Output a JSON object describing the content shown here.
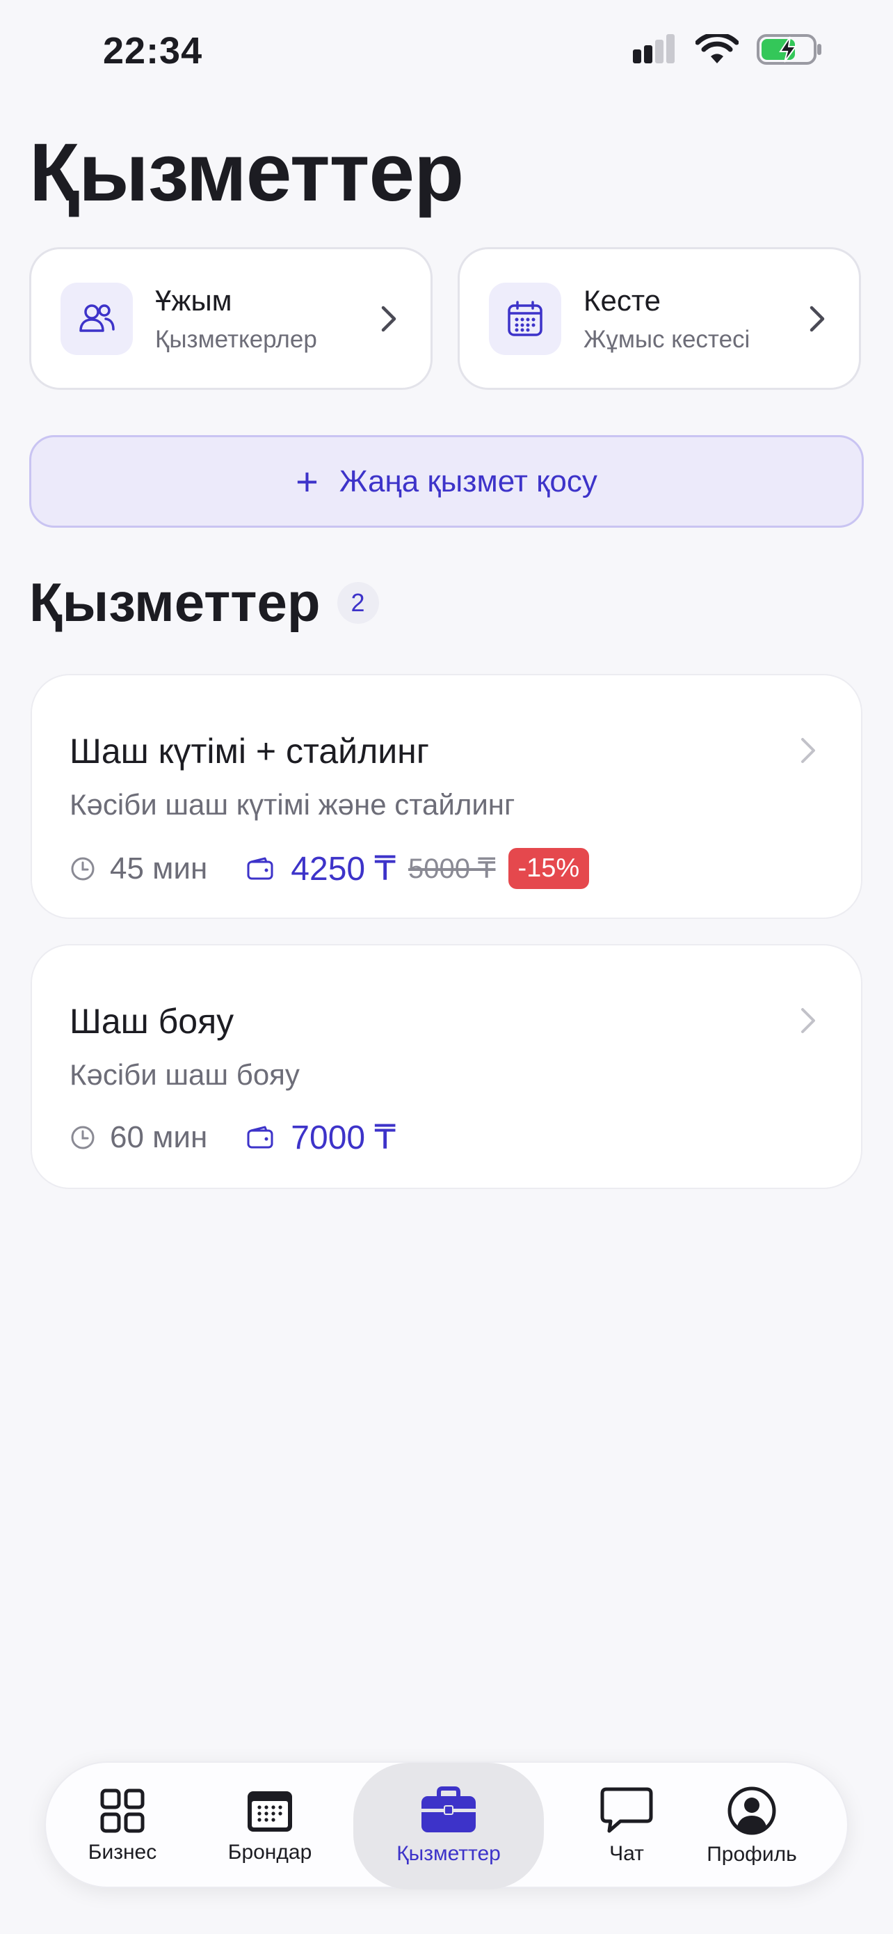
{
  "status_bar": {
    "time": "22:34"
  },
  "page": {
    "title": "Қызметтер"
  },
  "quick_cards": [
    {
      "title": "Ұжым",
      "subtitle": "Қызметкерлер",
      "icon": "team-icon"
    },
    {
      "title": "Кесте",
      "subtitle": "Жұмыс кестесі",
      "icon": "calendar-icon"
    }
  ],
  "add_button": {
    "label": "Жаңа қызмет қосу"
  },
  "services_section": {
    "title": "Қызметтер",
    "count": "2"
  },
  "services": [
    {
      "name": "Шаш күтімі + стайлинг",
      "description": "Кәсіби шаш күтімі және стайлинг",
      "duration": "45 мин",
      "price": "4250 ₸",
      "old_price": "5000 ₸",
      "discount": "-15%"
    },
    {
      "name": "Шаш бояу",
      "description": "Кәсіби шаш бояу",
      "duration": "60 мин",
      "price": "7000 ₸"
    }
  ],
  "tabbar": {
    "items": [
      {
        "label": "Бизнес",
        "icon": "grid-icon"
      },
      {
        "label": "Брондар",
        "icon": "calendar-icon"
      },
      {
        "label": "Қызметтер",
        "icon": "briefcase-icon",
        "active": true
      },
      {
        "label": "Чат",
        "icon": "chat-icon"
      },
      {
        "label": "Профиль",
        "icon": "profile-icon"
      }
    ]
  },
  "colors": {
    "accent": "#3d33c9",
    "discount": "#e5484d",
    "background": "#f7f7fa"
  }
}
